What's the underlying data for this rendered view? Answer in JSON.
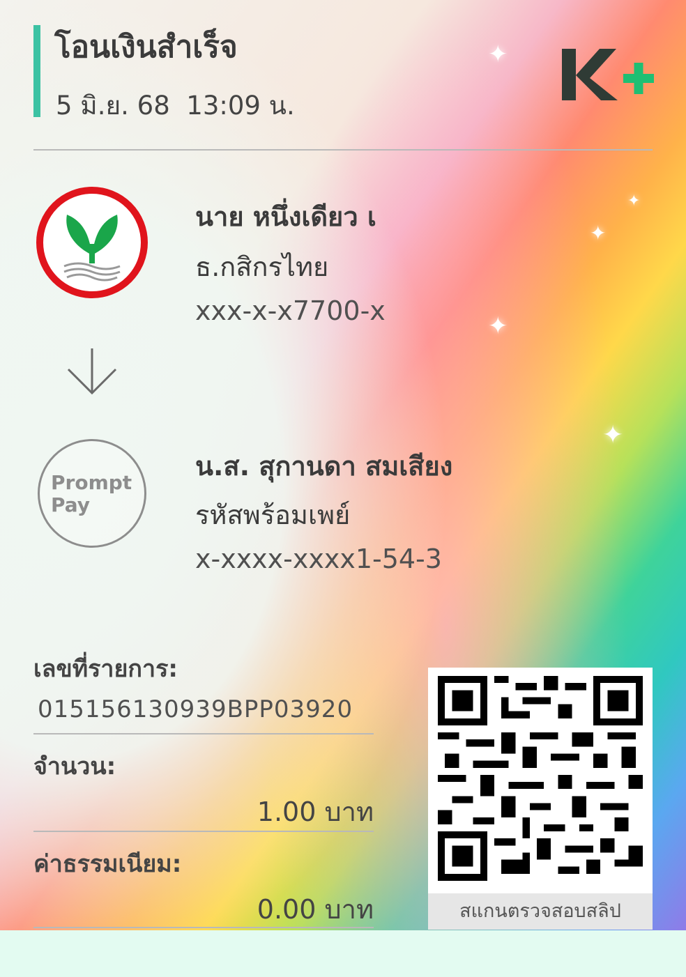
{
  "header": {
    "title": "โอนเงินสำเร็จ",
    "date": "5 มิ.ย. 68",
    "time": "13:09 น.",
    "brand_text": "K+"
  },
  "sender": {
    "logo_icon": "kasikorn-bank-logo",
    "name": "นาย หนึ่งเดียว เ",
    "bank": "ธ.กสิกรไทย",
    "account": "xxx-x-x7700-x"
  },
  "transfer_arrow_icon": "arrow-down-icon",
  "receiver": {
    "logo_icon": "promptpay-logo",
    "logo_line1": "Prompt",
    "logo_line2": "Pay",
    "name": "น.ส. สุกานดา สมเสียง",
    "channel": "รหัสพร้อมเพย์",
    "account": "x-xxxx-xxxx1-54-3"
  },
  "details": {
    "txn_label": "เลขที่รายการ:",
    "txn_value": "015156130939BPP03920",
    "amount_label": "จำนวน:",
    "amount_value": "1.00 บาท",
    "fee_label": "ค่าธรรมเนียม:",
    "fee_value": "0.00 บาท"
  },
  "qr": {
    "caption": "สแกนตรวจสอบสลิป"
  },
  "colors": {
    "accent": "#3cc2a3",
    "kbank_red": "#e0141c",
    "kbank_green": "#1aa64a",
    "kplus_dark": "#2f3b35",
    "kplus_green": "#1fbf73"
  }
}
